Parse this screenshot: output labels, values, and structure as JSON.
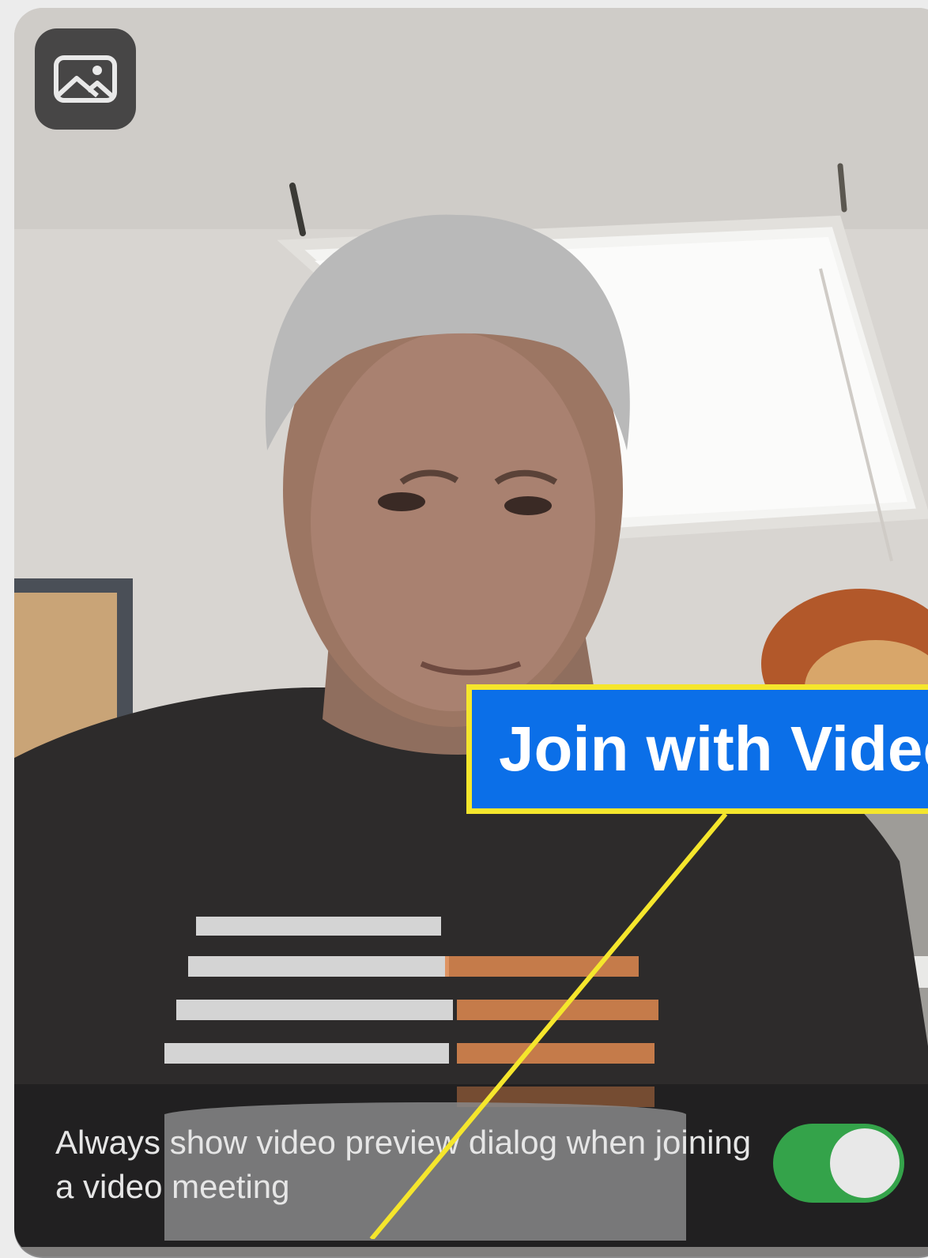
{
  "preview": {
    "background_button_icon": "image-icon",
    "join_button_label": "Join with Video",
    "always_show_label": "Always show video preview dialog when joining a video meeting",
    "always_show_toggle_on": true
  },
  "colors": {
    "join_button": "#0b6fe8",
    "callout_highlight": "#f5e62c",
    "toggle_on": "#34a34a"
  }
}
